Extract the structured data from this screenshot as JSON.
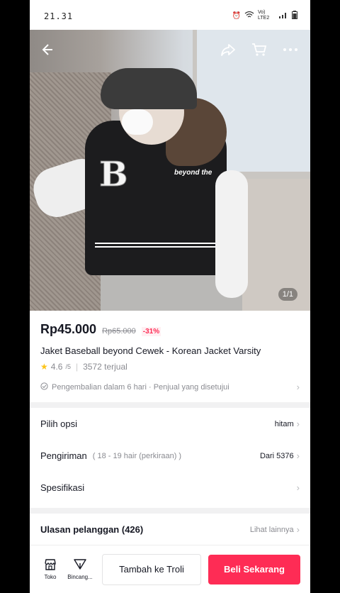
{
  "status": {
    "time": "21.31",
    "network": "Vo) LTE2"
  },
  "header": {
    "counter": "1/1"
  },
  "hero": {
    "jacket_letter": "B",
    "jacket_text": "beyond the"
  },
  "product": {
    "price": "Rp45.000",
    "original_price": "Rp65.000",
    "discount": "-31%",
    "title": "Jaket Baseball beyond Cewek - Korean Jacket Varsity",
    "rating": "4.6",
    "rating_max": "/5",
    "sold": "3572 terjual",
    "return_policy": "Pengembalian dalam 6 hari · Penjual yang disetujui"
  },
  "rows": {
    "options": {
      "label": "Pilih opsi",
      "value": "hitam"
    },
    "shipping": {
      "label": "Pengiriman",
      "hint": "( 18 - 19 hair (perkiraan) )",
      "value": "Dari 5376"
    },
    "specs": {
      "label": "Spesifikasi"
    }
  },
  "reviews": {
    "label": "Ulasan pelanggan (426)",
    "more": "Lihat lainnya"
  },
  "bottom": {
    "shop_label": "Toko",
    "chat_label": "Bincang...",
    "add_to_cart": "Tambah ke Troli",
    "buy_now": "Beli Sekarang"
  },
  "colors": {
    "accent": "#fe2c55",
    "star": "#fcc419"
  },
  "icons": [
    "back-icon",
    "share-icon",
    "cart-icon",
    "more-icon",
    "star-icon",
    "return-icon",
    "chevron-right-icon",
    "shop-icon",
    "chat-icon"
  ]
}
